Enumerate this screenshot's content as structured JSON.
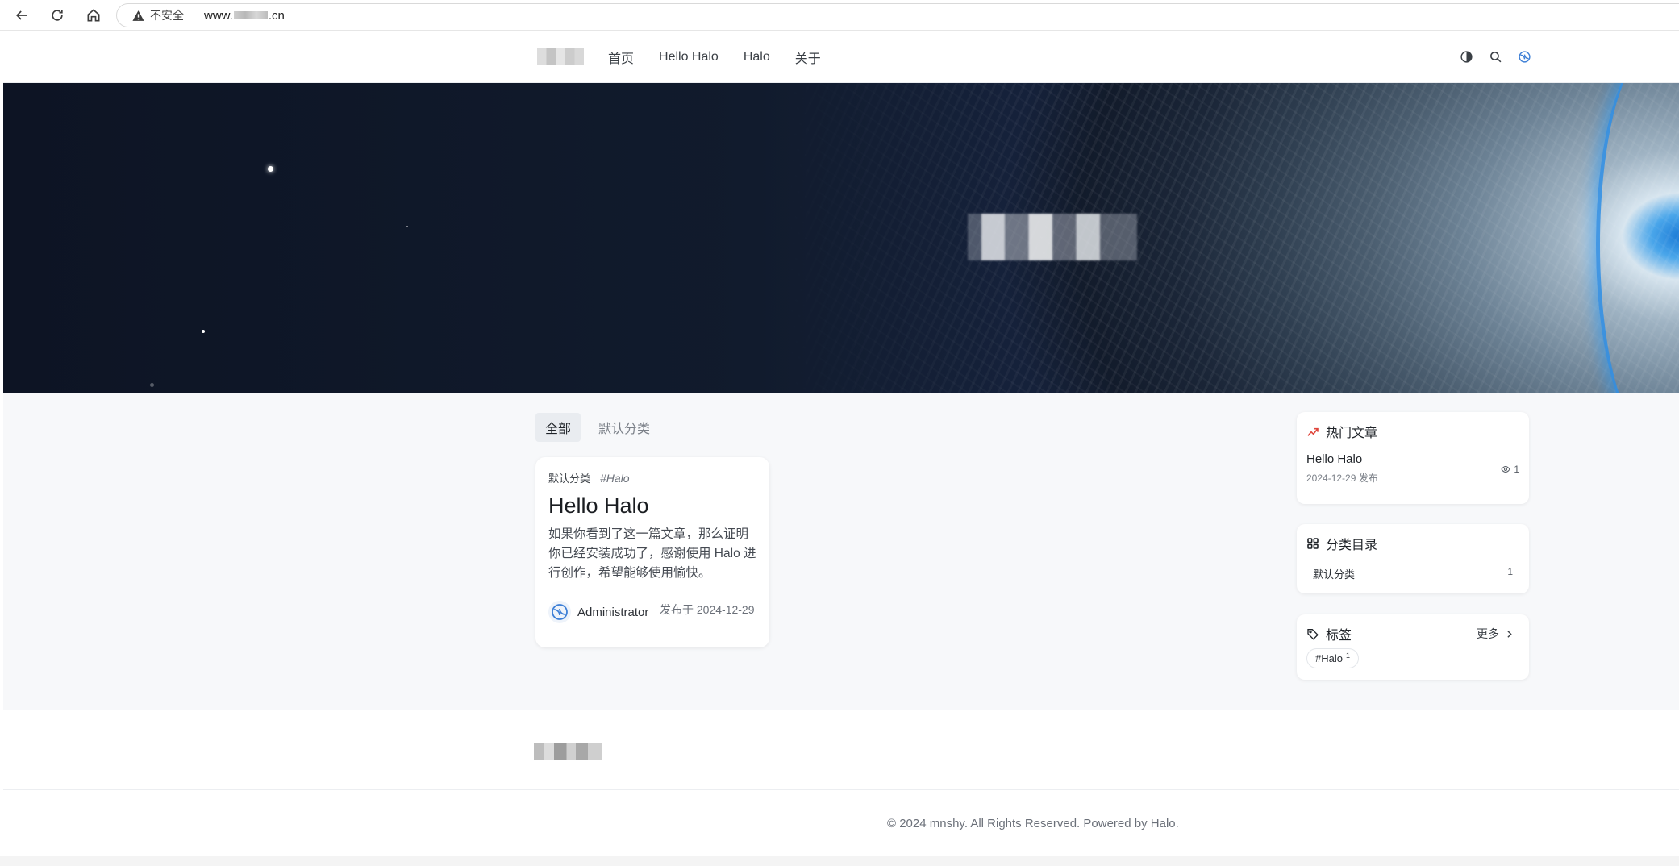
{
  "browser": {
    "security_label": "不安全",
    "url_prefix": "www.",
    "url_suffix": ".cn"
  },
  "nav": {
    "items": [
      {
        "label": "首页"
      },
      {
        "label": "Hello Halo"
      },
      {
        "label": "Halo"
      },
      {
        "label": "关于"
      }
    ]
  },
  "header_icons": [
    "contrast-icon",
    "search-icon",
    "halo-logo-icon"
  ],
  "tabs": [
    {
      "label": "全部",
      "active": true
    },
    {
      "label": "默认分类",
      "active": false
    }
  ],
  "post": {
    "category": "默认分类",
    "tag": "#Halo",
    "title": "Hello Halo",
    "excerpt": "如果你看到了这一篇文章，那么证明你已经安装成功了，感谢使用 Halo 进行创作，希望能够使用愉快。",
    "author": "Administrator",
    "date": "发布于 2024-12-29"
  },
  "widgets": {
    "hot": {
      "title": "热门文章",
      "post_title": "Hello Halo",
      "post_date": "2024-12-29 发布",
      "views": "1"
    },
    "categories": {
      "title": "分类目录",
      "items": [
        {
          "name": "默认分类",
          "count": "1"
        }
      ]
    },
    "tags": {
      "title": "标签",
      "more": "更多",
      "items": [
        {
          "name": "#Halo",
          "count": "1"
        }
      ]
    }
  },
  "footer": {
    "copyright": "© 2024 mnshy. All Rights Reserved. Powered by Halo."
  },
  "colors": {
    "page_bg": "#f7f8fa",
    "card_bg": "#ffffff",
    "text": "#1f2328",
    "muted": "#7b8088"
  }
}
